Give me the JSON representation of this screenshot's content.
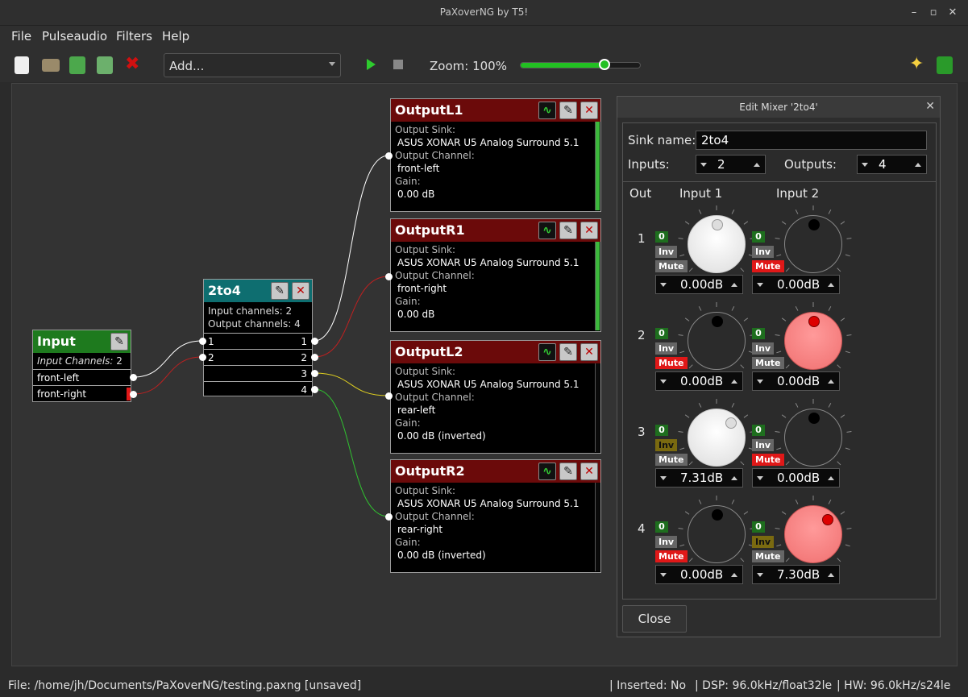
{
  "window": {
    "title": "PaXoverNG by T5!"
  },
  "menu": [
    "File",
    "Pulseaudio",
    "Filters",
    "Help"
  ],
  "toolbar": {
    "add_value": "Add...",
    "zoom_label": "Zoom: 100%",
    "zoom_percent": 100,
    "slider_level": 0.69
  },
  "nodes": {
    "input": {
      "title": "Input",
      "channels_label": "Input Channels:",
      "channels_value": "2",
      "ports": [
        "front-left",
        "front-right"
      ]
    },
    "mixer": {
      "title": "2to4",
      "in_label": "Input channels:",
      "in_value": "2",
      "out_label": "Output channels:",
      "out_value": "4",
      "rows": [
        [
          "1",
          "1"
        ],
        [
          "2",
          "2"
        ],
        [
          "",
          "3"
        ],
        [
          "",
          "4"
        ]
      ]
    },
    "outputs": [
      {
        "title": "OutputL1",
        "sink_label": "Output Sink:",
        "sink": "ASUS XONAR U5 Analog Surround 5.1",
        "ch_label": "Output Channel:",
        "channel": "front-left",
        "gain_label": "Gain:",
        "gain": "0.00 dB",
        "level": 1.0
      },
      {
        "title": "OutputR1",
        "sink_label": "Output Sink:",
        "sink": "ASUS XONAR U5 Analog Surround 5.1",
        "ch_label": "Output Channel:",
        "channel": "front-right",
        "gain_label": "Gain:",
        "gain": "0.00 dB",
        "level": 1.0
      },
      {
        "title": "OutputL2",
        "sink_label": "Output Sink:",
        "sink": "ASUS XONAR U5 Analog Surround 5.1",
        "ch_label": "Output Channel:",
        "channel": "rear-left",
        "gain_label": "Gain:",
        "gain": "0.00 dB (inverted)",
        "level": 0.0
      },
      {
        "title": "OutputR2",
        "sink_label": "Output Sink:",
        "sink": "ASUS XONAR U5 Analog Surround 5.1",
        "ch_label": "Output Channel:",
        "channel": "rear-right",
        "gain_label": "Gain:",
        "gain": "0.00 dB (inverted)",
        "level": 0.0
      }
    ]
  },
  "dialog": {
    "title": "Edit Mixer '2to4'",
    "sink_name_label": "Sink name:",
    "sink_name": "2to4",
    "inputs_label": "Inputs:",
    "inputs": "2",
    "outputs_label": "Outputs:",
    "outputs": "4",
    "col_out": "Out",
    "col_in1": "Input 1",
    "col_in2": "Input 2",
    "zero": "0",
    "inv": "Inv",
    "mute": "Mute",
    "close": "Close",
    "rows": [
      {
        "out": "1",
        "c1": {
          "gain": "0.00dB",
          "inv": false,
          "mute": false,
          "style": "white"
        },
        "c2": {
          "gain": "0.00dB",
          "inv": false,
          "mute": true,
          "style": "dark"
        }
      },
      {
        "out": "2",
        "c1": {
          "gain": "0.00dB",
          "inv": false,
          "mute": true,
          "style": "dark"
        },
        "c2": {
          "gain": "0.00dB",
          "inv": false,
          "mute": false,
          "style": "pink"
        }
      },
      {
        "out": "3",
        "c1": {
          "gain": "7.31dB",
          "inv": true,
          "mute": false,
          "style": "white"
        },
        "c2": {
          "gain": "0.00dB",
          "inv": false,
          "mute": true,
          "style": "dark"
        }
      },
      {
        "out": "4",
        "c1": {
          "gain": "0.00dB",
          "inv": false,
          "mute": true,
          "style": "dark"
        },
        "c2": {
          "gain": "7.30dB",
          "inv": true,
          "mute": false,
          "style": "pink"
        }
      }
    ]
  },
  "status": {
    "file": "File: /home/jh/Documents/PaXoverNG/testing.paxng [unsaved]",
    "inserted": "| Inserted: No",
    "dsp": "| DSP: 96.0kHz/float32le",
    "hw": "| HW: 96.0kHz/s24le"
  },
  "colors": {
    "accent": "#22c022",
    "mute": "#e01818",
    "out_header": "#6b0a0a",
    "mixer_header": "#0e6e70",
    "input_header": "#1e7a1e"
  }
}
